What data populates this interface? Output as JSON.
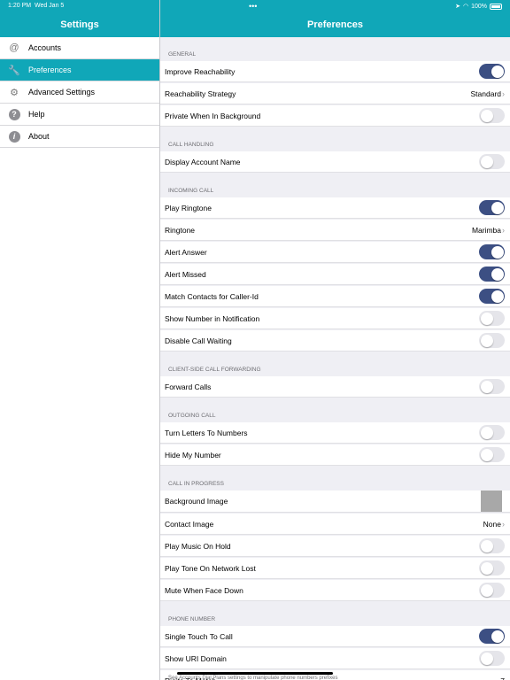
{
  "status_bar": {
    "time": "1:20 PM",
    "date": "Wed Jan 5",
    "battery": "100%"
  },
  "sidebar": {
    "title": "Settings",
    "items": [
      {
        "label": "Accounts",
        "icon": "at-icon",
        "glyph": "@",
        "active": false
      },
      {
        "label": "Preferences",
        "icon": "wrench-icon",
        "glyph": "🔧",
        "active": true
      },
      {
        "label": "Advanced Settings",
        "icon": "gears-icon",
        "glyph": "⚙",
        "active": false
      },
      {
        "label": "Help",
        "icon": "question-icon",
        "glyph": "?",
        "active": false
      },
      {
        "label": "About",
        "icon": "info-icon",
        "glyph": "i",
        "active": false
      }
    ]
  },
  "main": {
    "title": "Preferences",
    "sections": [
      {
        "header": "GENERAL",
        "rows": [
          {
            "label": "Improve Reachability",
            "type": "toggle",
            "on": true
          },
          {
            "label": "Reachability Strategy",
            "type": "value",
            "value": "Standard"
          },
          {
            "label": "Private When In Background",
            "type": "toggle",
            "on": false
          }
        ]
      },
      {
        "header": "CALL HANDLING",
        "rows": [
          {
            "label": "Display Account Name",
            "type": "toggle",
            "on": false
          }
        ]
      },
      {
        "header": "INCOMING CALL",
        "rows": [
          {
            "label": "Play Ringtone",
            "type": "toggle",
            "on": true
          },
          {
            "label": "Ringtone",
            "type": "value",
            "value": "Marimba"
          },
          {
            "label": "Alert Answer",
            "type": "toggle",
            "on": true
          },
          {
            "label": "Alert Missed",
            "type": "toggle",
            "on": true
          },
          {
            "label": "Match Contacts for Caller-Id",
            "type": "toggle",
            "on": true
          },
          {
            "label": "Show Number in Notification",
            "type": "toggle",
            "on": false
          },
          {
            "label": "Disable Call Waiting",
            "type": "toggle",
            "on": false
          }
        ]
      },
      {
        "header": "CLIENT-SIDE CALL FORWARDING",
        "rows": [
          {
            "label": "Forward Calls",
            "type": "toggle",
            "on": false
          }
        ]
      },
      {
        "header": "OUTGOING CALL",
        "rows": [
          {
            "label": "Turn Letters To Numbers",
            "type": "toggle",
            "on": false
          },
          {
            "label": "Hide My Number",
            "type": "toggle",
            "on": false
          }
        ]
      },
      {
        "header": "CALL IN PROGRESS",
        "rows": [
          {
            "label": "Background Image",
            "type": "image"
          },
          {
            "label": "Contact Image",
            "type": "value",
            "value": "None"
          },
          {
            "label": "Play Music On Hold",
            "type": "toggle",
            "on": false
          },
          {
            "label": "Play Tone On Network Lost",
            "type": "toggle",
            "on": false
          },
          {
            "label": "Mute When Face Down",
            "type": "toggle",
            "on": false
          }
        ]
      },
      {
        "header": "PHONE NUMBER",
        "rows": [
          {
            "label": "Single Touch To Call",
            "type": "toggle",
            "on": true
          },
          {
            "label": "Show URI Domain",
            "type": "toggle",
            "on": false
          },
          {
            "label": "Digits To Match",
            "type": "text",
            "value": "7"
          }
        ]
      }
    ],
    "footer_note": "See Accounts Dial Plans settings to manipulate phone numbers prefixes"
  },
  "colors": {
    "accent": "#10a7b8",
    "toggle_on": "#3c4f83",
    "toggle_off": "#e5e5ea",
    "background": "#efeff4"
  }
}
